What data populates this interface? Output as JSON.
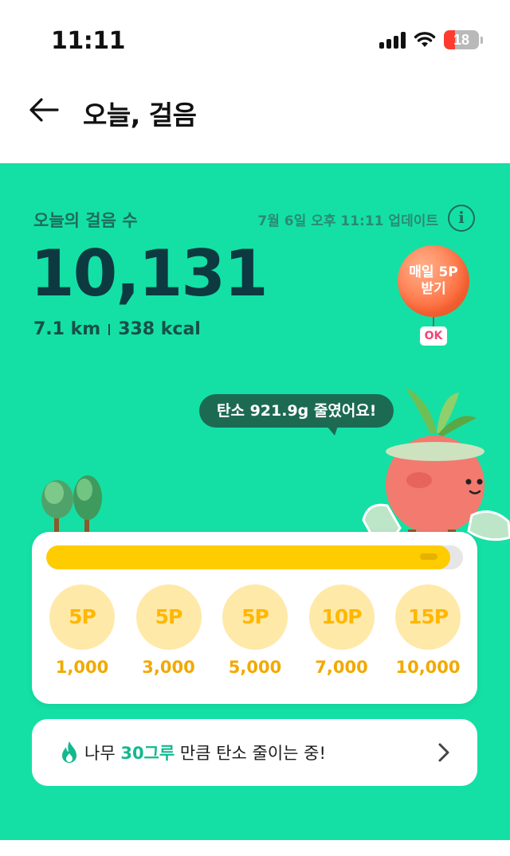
{
  "status_bar": {
    "time": "11:11",
    "battery_level": "18"
  },
  "nav": {
    "title": "오늘, 걸음"
  },
  "summary": {
    "label": "오늘의 걸음 수",
    "updated": "7월 6일 오후 11:11 업데이트",
    "steps": "10,131",
    "distance": "7.1 km",
    "calories": "338 kcal"
  },
  "promo": {
    "line1": "매일 5P",
    "line2": "받기",
    "badge": "OK"
  },
  "bubble": {
    "text": "탄소 921.9g 줄였어요!"
  },
  "progress": {
    "fraction": 0.97,
    "milestones": [
      {
        "points": "5P",
        "steps": "1,000"
      },
      {
        "points": "5P",
        "steps": "3,000"
      },
      {
        "points": "5P",
        "steps": "5,000"
      },
      {
        "points": "10P",
        "steps": "7,000"
      },
      {
        "points": "15P",
        "steps": "10,000"
      }
    ]
  },
  "carbon": {
    "prefix": "나무 ",
    "highlight": "30그루",
    "suffix": " 만큼 탄소 줄이는 중!"
  },
  "colors": {
    "background_green": "#14e0a5",
    "progress_yellow": "#ffcc00",
    "highlight_teal": "#14b88f"
  },
  "icons": [
    "back-arrow-icon",
    "info-icon",
    "flame-icon",
    "chevron-right-icon",
    "signal-icon",
    "wifi-icon",
    "battery-icon"
  ]
}
